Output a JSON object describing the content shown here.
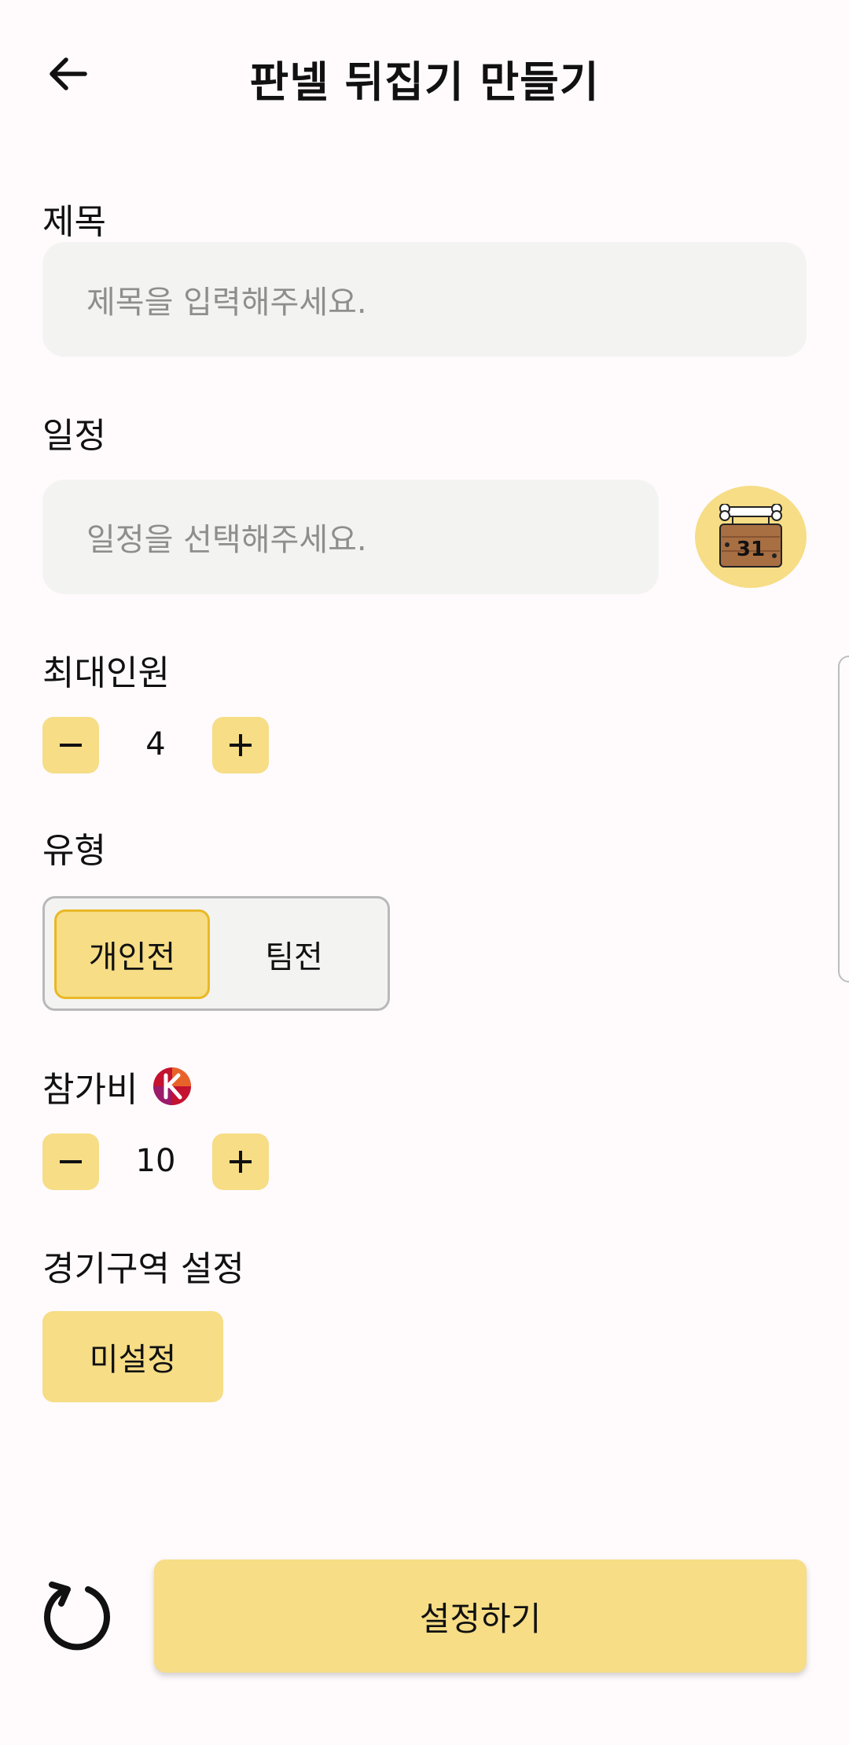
{
  "header": {
    "title": "판넬 뒤집기 만들기"
  },
  "form": {
    "title_label": "제목",
    "title_placeholder": "제목을 입력해주세요.",
    "schedule_label": "일정",
    "schedule_placeholder": "일정을 선택해주세요.",
    "calendar_day": "31",
    "max_people_label": "최대인원",
    "max_people_value": "4",
    "type_label": "유형",
    "type_options": [
      "개인전",
      "팀전"
    ],
    "type_selected": "개인전",
    "fee_label": "참가비",
    "fee_value": "10",
    "zone_label": "경기구역 설정",
    "zone_value": "미설정"
  },
  "footer": {
    "submit_label": "설정하기"
  },
  "colors": {
    "accent": "#f6dd86",
    "accent_border": "#eab826",
    "input_bg": "#f3f4f2"
  }
}
